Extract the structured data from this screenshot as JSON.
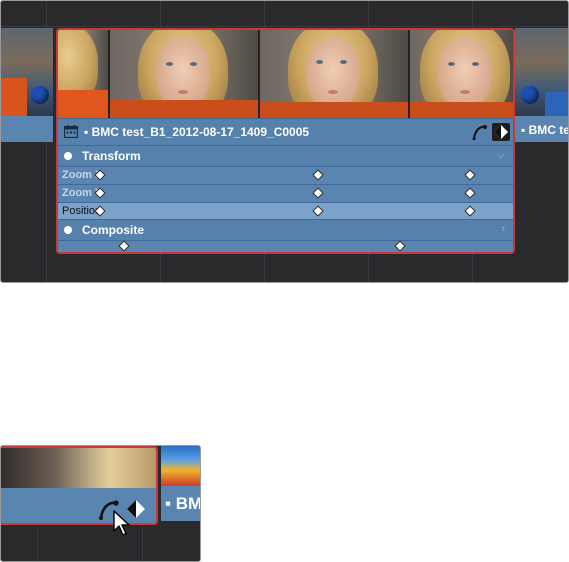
{
  "top": {
    "clip_title": "▪ BMC test_B1_2012-08-17_1409_C0005",
    "right_clip_label": "▪ BMC test",
    "sections": [
      {
        "label": "Transform",
        "expanded": true
      },
      {
        "label": "Composite",
        "expanded": false
      }
    ],
    "params": [
      {
        "label": "Zoom X",
        "selected": false
      },
      {
        "label": "Zoom Y",
        "selected": false
      },
      {
        "label": "Position",
        "selected": true
      }
    ]
  },
  "bottom": {
    "next_clip_label": "▪ BMC"
  },
  "icons": {
    "calendar": "clip-calendar-icon",
    "curve": "curve-editor-icon",
    "keyframe": "keyframe-editor-icon",
    "cursor": "mouse-pointer-icon"
  },
  "colors": {
    "clip_blue": "#5b85b1",
    "selected_row": "#7aa2cb",
    "selection_border": "#c53b3b",
    "timeline_bg": "#2a2a2d"
  }
}
